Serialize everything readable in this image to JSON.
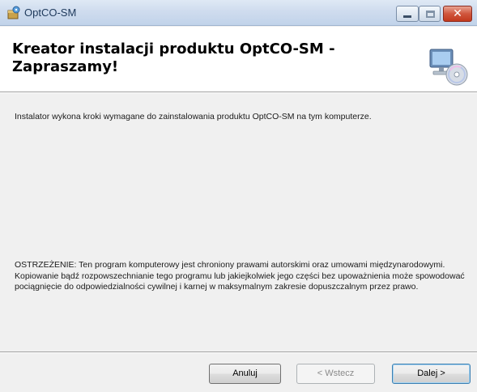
{
  "window": {
    "title": "OptCO-SM",
    "controls": {
      "minimize_icon": "minimize-icon",
      "maximize_icon": "maximize-icon",
      "close_icon": "close-icon",
      "close_glyph": "✕"
    }
  },
  "header": {
    "title": "Kreator instalacji produktu OptCO-SM - Zapraszamy!",
    "icon": "computer-cd-icon"
  },
  "body": {
    "intro": "Instalator wykona kroki wymagane do zainstalowania produktu OptCO-SM na tym komputerze.",
    "warning": "OSTRZEŻENIE: Ten program komputerowy jest chroniony prawami autorskimi oraz umowami międzynarodowymi. Kopiowanie bądź rozpowszechnianie tego programu lub jakiejkolwiek jego części bez upoważnienia może spowodować pociągnięcie do odpowiedzialności cywilnej i karnej w maksymalnym zakresie dopuszczalnym przez prawo."
  },
  "buttons": {
    "cancel": "Anuluj",
    "back": "< Wstecz",
    "next": "Dalej >"
  },
  "colors": {
    "titlebar": "#cfdcee",
    "header_bg": "#ffffff",
    "dialog_bg": "#f0f0f0",
    "close_button": "#c2391d",
    "default_button_border": "#3c7fb1"
  }
}
